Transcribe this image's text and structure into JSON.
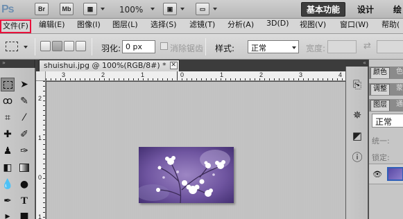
{
  "app": {
    "logo": "Ps",
    "bridge": "Br",
    "mini_bridge": "Mb",
    "zoom": "100%",
    "workspaces": [
      "基本功能",
      "设计",
      "绘"
    ],
    "active_workspace_index": 0
  },
  "menu": [
    "文件(F)",
    "编辑(E)",
    "图像(I)",
    "图层(L)",
    "选择(S)",
    "滤镜(T)",
    "分析(A)",
    "3D(D)",
    "视图(V)",
    "窗口(W)",
    "帮助("
  ],
  "options": {
    "feather_label": "羽化:",
    "feather_value": "0 px",
    "antialias_label": "消除锯齿",
    "style_label": "样式:",
    "style_value": "正常",
    "width_label": "宽度:"
  },
  "document": {
    "tab_title": "shuishui.jpg @ 100%(RGB/8#) *",
    "close_glyph": "✕"
  },
  "rulers": {
    "horizontal": [
      "3",
      "2",
      "1",
      "0",
      "1",
      "2",
      "3",
      "4",
      "5"
    ],
    "vertical": [
      "2",
      "1",
      "0",
      "1"
    ]
  },
  "panels": {
    "top_tabs": [
      "颜色",
      "色"
    ],
    "adjust_tabs": [
      "调整",
      "蒙"
    ],
    "layer_tabs": [
      "图层",
      "通"
    ],
    "blend_mode": "正常",
    "unify_label": "统一:",
    "lock_label": "锁定:"
  },
  "colors": {
    "accent_red": "#e8113c",
    "workspace_active": "#3d3d3d",
    "canvas_bg": "#c4c4c4",
    "photo_purple": "#7a5fa6"
  }
}
